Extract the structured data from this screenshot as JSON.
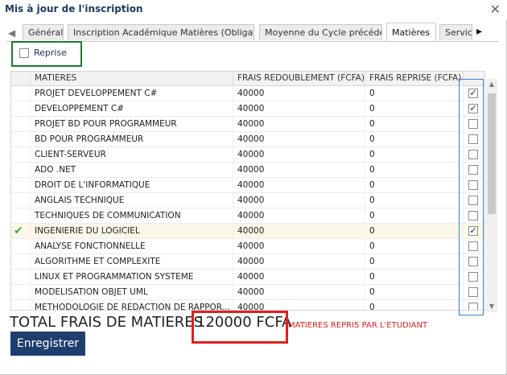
{
  "window": {
    "title": "Mis à jour de l'inscription",
    "close_icon": "close-icon"
  },
  "tabs": [
    {
      "label": "Général"
    },
    {
      "label": "Inscription Académique Matières (Obligatoire)"
    },
    {
      "label": "Moyenne du Cycle précédent"
    },
    {
      "label": "Matières"
    },
    {
      "label": "Service"
    }
  ],
  "tab_scroll": {
    "left_icon": "chevron-left-icon",
    "right_icon": "chevron-right-icon"
  },
  "reprise": {
    "label": "Reprise",
    "checked": false
  },
  "grid": {
    "columns": [
      "MATIERES",
      "FRAIS REDOUBLEMENT (FCFA)",
      "FRAIS REPRISE (FCFA)"
    ],
    "rows": [
      {
        "matiere": "PROJET DEVELOPPEMENT C#",
        "frais_redoublement": "40000",
        "frais_reprise": "0",
        "checked": true,
        "current": false
      },
      {
        "matiere": "DEVELOPPEMENT C#",
        "frais_redoublement": "40000",
        "frais_reprise": "0",
        "checked": true,
        "current": false
      },
      {
        "matiere": "PROJET BD POUR PROGRAMMEUR",
        "frais_redoublement": "40000",
        "frais_reprise": "0",
        "checked": false,
        "current": false
      },
      {
        "matiere": "BD POUR PROGRAMMEUR",
        "frais_redoublement": "40000",
        "frais_reprise": "0",
        "checked": false,
        "current": false
      },
      {
        "matiere": "CLIENT-SERVEUR",
        "frais_redoublement": "40000",
        "frais_reprise": "0",
        "checked": false,
        "current": false
      },
      {
        "matiere": "ADO .NET",
        "frais_redoublement": "40000",
        "frais_reprise": "0",
        "checked": false,
        "current": false
      },
      {
        "matiere": "DROIT DE L'INFORMATIQUE",
        "frais_redoublement": "40000",
        "frais_reprise": "0",
        "checked": false,
        "current": false
      },
      {
        "matiere": "ANGLAIS TECHNIQUE",
        "frais_redoublement": "40000",
        "frais_reprise": "0",
        "checked": false,
        "current": false
      },
      {
        "matiere": "TECHNIQUES DE COMMUNICATION",
        "frais_redoublement": "40000",
        "frais_reprise": "0",
        "checked": false,
        "current": false
      },
      {
        "matiere": "INGENIERIE DU LOGICIEL",
        "frais_redoublement": "40000",
        "frais_reprise": "0",
        "checked": true,
        "current": true
      },
      {
        "matiere": "ANALYSE FONCTIONNELLE",
        "frais_redoublement": "40000",
        "frais_reprise": "0",
        "checked": false,
        "current": false
      },
      {
        "matiere": "ALGORITHME ET COMPLEXITE",
        "frais_redoublement": "40000",
        "frais_reprise": "0",
        "checked": false,
        "current": false
      },
      {
        "matiere": "LINUX ET PROGRAMMATION SYSTEME",
        "frais_redoublement": "40000",
        "frais_reprise": "0",
        "checked": false,
        "current": false
      },
      {
        "matiere": "MODELISATION OBJET UML",
        "frais_redoublement": "40000",
        "frais_reprise": "0",
        "checked": false,
        "current": false
      },
      {
        "matiere": "METHODOLOGIE DE REDACTION DE RAPPORTS…",
        "frais_redoublement": "40000",
        "frais_reprise": "0",
        "checked": false,
        "current": false
      }
    ]
  },
  "total": {
    "label": "TOTAL FRAIS DE MATIERES",
    "value": "120000 FCFA",
    "note": "MATIERES REPRIS PAR L'ETUDIANT"
  },
  "save_button": {
    "label": "Enregistrer"
  },
  "colors": {
    "title": "#1f3a63",
    "save_button": "#1e3e6e",
    "highlight_box": "#e02020",
    "reprise_box": "#1e7a2e",
    "check_column_frame": "#3c7fc8",
    "current_row_indicator": "#3bb03b"
  }
}
